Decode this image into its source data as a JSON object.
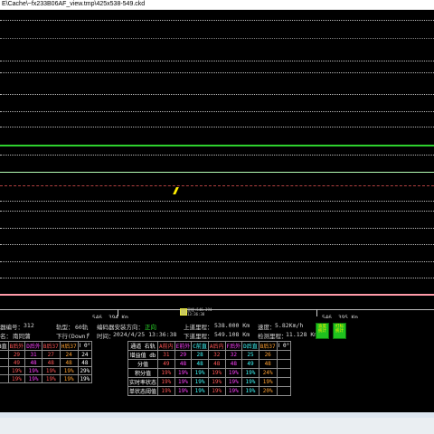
{
  "window": {
    "title": "E\\Cache\\~fx233B06AF_view.tmp\\425x538-549.ckd"
  },
  "colors": {
    "background": "#000000",
    "green_rail": "#2ed12e",
    "pink_rail": "#ff9aa8",
    "red_dashed": "#b04040",
    "badge_green": "#1fc21f",
    "badge_text": "#ffee00",
    "val_red": "#ff5555",
    "val_orange": "#ffa030",
    "val_magenta": "#ff40ff",
    "val_green": "#40ff40",
    "val_cyan": "#40ffff",
    "val_white": "#ffffff"
  },
  "ruler": {
    "left_km": "546. 394  Km",
    "right_km": "546. 395  Km",
    "marker_text": "里程:546.394\n13:36:38"
  },
  "info": {
    "row1": {
      "label_a": "器编号：",
      "value_a": "312",
      "label_b": "轨型：",
      "value_b": "60轨",
      "label_c": "编码器安装方向：",
      "value_c": "正向",
      "label_d": "上道里程：",
      "value_d": "538.000 Km",
      "label_e": "速度：",
      "value_e": "5.82Km/h"
    },
    "row2": {
      "label_a": "名：",
      "value_a": "南同蒲",
      "label_b": "下行(Down)",
      "value_b": "↑",
      "label_c": "时间：",
      "value_c": "2024/4/25 13:36:38",
      "label_d": "下道里程：",
      "value_d": "549.108 Km",
      "label_e": "检测里程：",
      "value_e": "11.128 Km"
    },
    "badges": [
      "波度统计",
      "打标统计"
    ]
  },
  "table_left": {
    "header": [
      "B直",
      "B后外",
      "D后外",
      "B后37",
      "H后37",
      "Ⅰ 0°"
    ],
    "rows": [
      [
        "29",
        "31",
        "27",
        "24",
        "24"
      ],
      [
        "49",
        "48",
        "48",
        "48",
        "48"
      ],
      [
        "19%",
        "19%",
        "19%",
        "19%",
        "29%"
      ],
      [
        "19%",
        "19%",
        "19%",
        "19%",
        "19%"
      ]
    ]
  },
  "table_right": {
    "header": [
      "通道 右轨",
      "A前内",
      "E前外",
      "C前直",
      "A后内",
      "F后外",
      "D后直",
      "B后37",
      "Ⅰ 0°"
    ],
    "rows": [
      [
        "增益值 db",
        "31",
        "29",
        "28",
        "32",
        "32",
        "25",
        "26"
      ],
      [
        "分值",
        "49",
        "48",
        "48",
        "48",
        "48",
        "49",
        "48"
      ],
      [
        "积分值",
        "19%",
        "19%",
        "19%",
        "19%",
        "19%",
        "19%",
        "24%"
      ],
      [
        "实时率状态",
        "19%",
        "19%",
        "19%",
        "19%",
        "19%",
        "19%",
        "19%"
      ],
      [
        "单状态阈值",
        "19%",
        "19%",
        "19%",
        "19%",
        "19%",
        "19%",
        "20%"
      ]
    ]
  }
}
